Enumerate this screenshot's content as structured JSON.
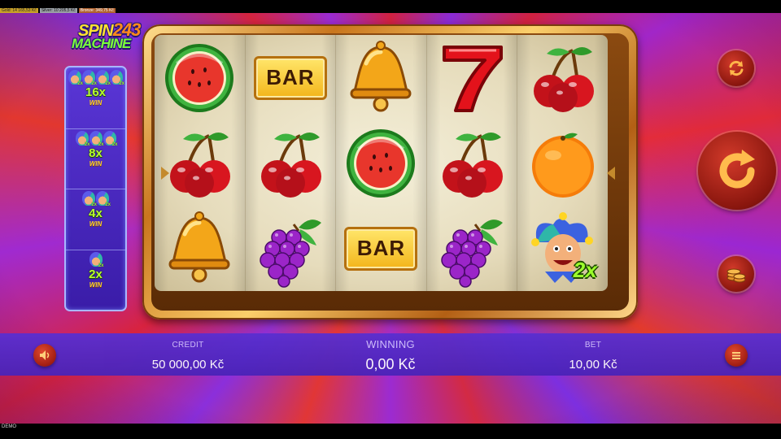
{
  "jackpots": {
    "gold": "Gold: 14 165,53 Kč",
    "silver": "Silver: 10 205,5 Kč",
    "bronze": "Bronze: 349,75 Kč"
  },
  "game": {
    "logo_line1": "SPIN",
    "logo_number": "243",
    "logo_line2": "MACHINE"
  },
  "paytable": [
    {
      "jokers": 4,
      "mini_multiplier": "2x",
      "multiplier": "16x",
      "win_label": "WIN"
    },
    {
      "jokers": 3,
      "mini_multiplier": "2x",
      "multiplier": "8x",
      "win_label": "WIN"
    },
    {
      "jokers": 2,
      "mini_multiplier": "2x",
      "multiplier": "4x",
      "win_label": "WIN"
    },
    {
      "jokers": 1,
      "mini_multiplier": "2x",
      "multiplier": "2x",
      "win_label": "WIN"
    }
  ],
  "reels": [
    [
      "watermelon",
      "cherry",
      "bell"
    ],
    [
      "bar",
      "cherry",
      "grapes"
    ],
    [
      "bell",
      "watermelon",
      "bar"
    ],
    [
      "seven",
      "cherry",
      "grapes"
    ],
    [
      "cherry",
      "orange",
      "joker"
    ]
  ],
  "symbols": {
    "bar_label": "BAR",
    "joker_multiplier": "2x"
  },
  "info": {
    "credit_label": "CREDIT",
    "credit_value": "50 000,00 Kč",
    "winning_label": "WINNING",
    "winning_value": "0,00 Kč",
    "bet_label": "BET",
    "bet_value": "10,00 Kč"
  },
  "footer": {
    "demo_label": "DEMO"
  },
  "colors": {
    "accent_button": "#a11d12",
    "info_bar": "#4a23b8",
    "frame_gold": "#fbcf6b"
  },
  "icons": {
    "autoplay": "autoplay-icon",
    "spin": "spin-icon",
    "bet": "coins-icon",
    "sound": "speaker-icon",
    "menu": "menu-icon"
  }
}
